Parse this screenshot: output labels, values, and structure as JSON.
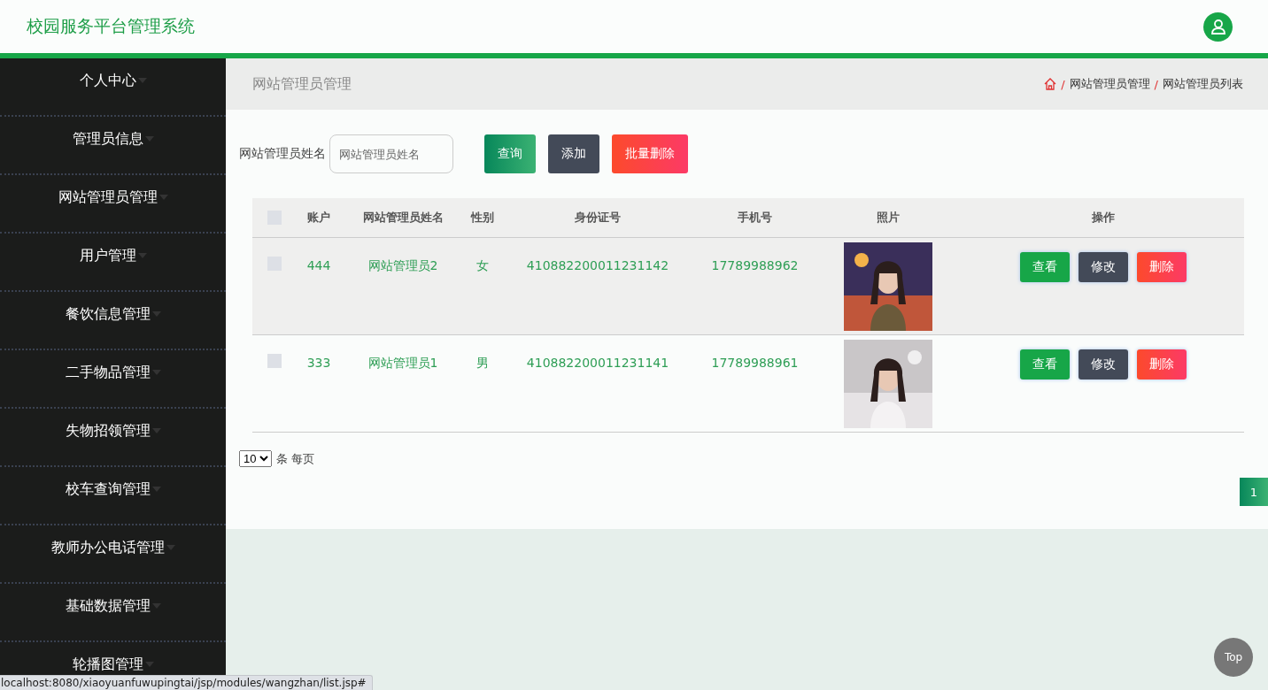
{
  "header": {
    "title": "校园服务平台管理系统"
  },
  "sidebar": {
    "items": [
      {
        "label": "个人中心"
      },
      {
        "label": "管理员信息"
      },
      {
        "label": "网站管理员管理"
      },
      {
        "label": "用户管理"
      },
      {
        "label": "餐饮信息管理"
      },
      {
        "label": "二手物品管理"
      },
      {
        "label": "失物招领管理"
      },
      {
        "label": "校车查询管理"
      },
      {
        "label": "教师办公电话管理"
      },
      {
        "label": "基础数据管理"
      },
      {
        "label": "轮播图管理"
      }
    ]
  },
  "page_title": "网站管理员管理",
  "breadcrumb": [
    {
      "separator": "/",
      "label": "网站管理员管理"
    },
    {
      "separator": "/",
      "label": "网站管理员列表"
    }
  ],
  "search": {
    "label": "网站管理员姓名",
    "placeholder": "网站管理员姓名"
  },
  "buttons": [
    {
      "label": "查询",
      "kind": "search"
    },
    {
      "label": "添加",
      "kind": "add"
    },
    {
      "label": "批量删除",
      "kind": "delete"
    }
  ],
  "table": {
    "select_all": {
      "checked": false
    },
    "columns": [
      "账户",
      "网站管理员姓名",
      "性别",
      "身份证号",
      "手机号",
      "照片",
      "操作"
    ],
    "rows": [
      {
        "checked": false,
        "highlighted": true,
        "account": "444",
        "name": "网站管理员2",
        "gender": "女",
        "id_number": "410882200011231142",
        "phone": "17789988962",
        "actions": [
          {
            "label": "查看",
            "kind": "view"
          },
          {
            "label": "修改",
            "kind": "edit"
          },
          {
            "label": "删除",
            "kind": "delete"
          }
        ]
      },
      {
        "checked": false,
        "highlighted": false,
        "account": "333",
        "name": "网站管理员1",
        "gender": "男",
        "id_number": "410882200011231141",
        "phone": "17789988961",
        "actions": [
          {
            "label": "查看",
            "kind": "view"
          },
          {
            "label": "修改",
            "kind": "edit"
          },
          {
            "label": "删除",
            "kind": "delete"
          }
        ]
      }
    ]
  },
  "pagination": {
    "page_size": "10",
    "page_size_label": "条 每页",
    "pages": [
      {
        "label": "1",
        "selected": true
      }
    ]
  },
  "top_button": "Top",
  "status_bar": "localhost:8080/xiaoyuanfuwupingtai/jsp/modules/wangzhan/list.jsp#"
}
